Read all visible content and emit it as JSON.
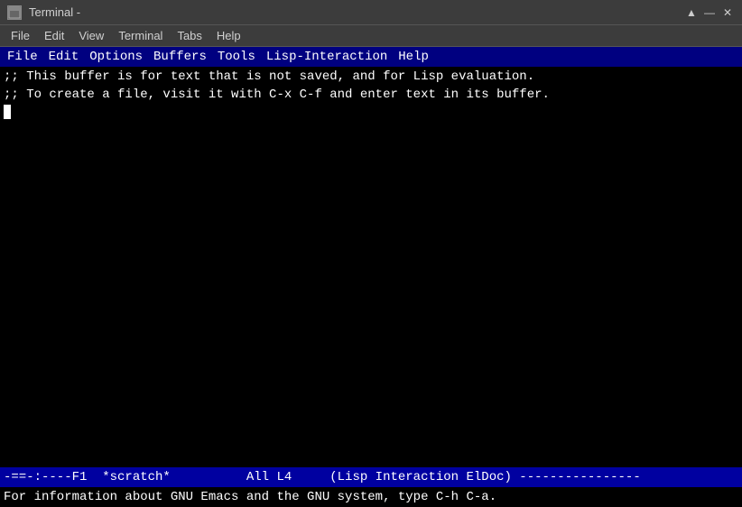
{
  "titlebar": {
    "title": "Terminal -",
    "icon_label": "T",
    "controls": {
      "minimize": "▲",
      "maximize_restore": "—",
      "close_x": "✕"
    }
  },
  "terminal_menu": {
    "items": [
      "File",
      "Edit",
      "View",
      "Terminal",
      "Tabs",
      "Help"
    ]
  },
  "emacs": {
    "menubar": {
      "items": [
        "File",
        "Edit",
        "Options",
        "Buffers",
        "Tools",
        "Lisp-Interaction",
        "Help"
      ]
    },
    "editor": {
      "lines": [
        ";; This buffer is for text that is not saved, and for Lisp evaluation.",
        ";; To create a file, visit it with C-x C-f and enter text in its buffer.",
        ""
      ]
    },
    "modeline": "-==-:----F1  *scratch*          All L4     (Lisp Interaction ElDoc) ----------------",
    "echo": "For information about GNU Emacs and the GNU system, type C-h C-a."
  }
}
